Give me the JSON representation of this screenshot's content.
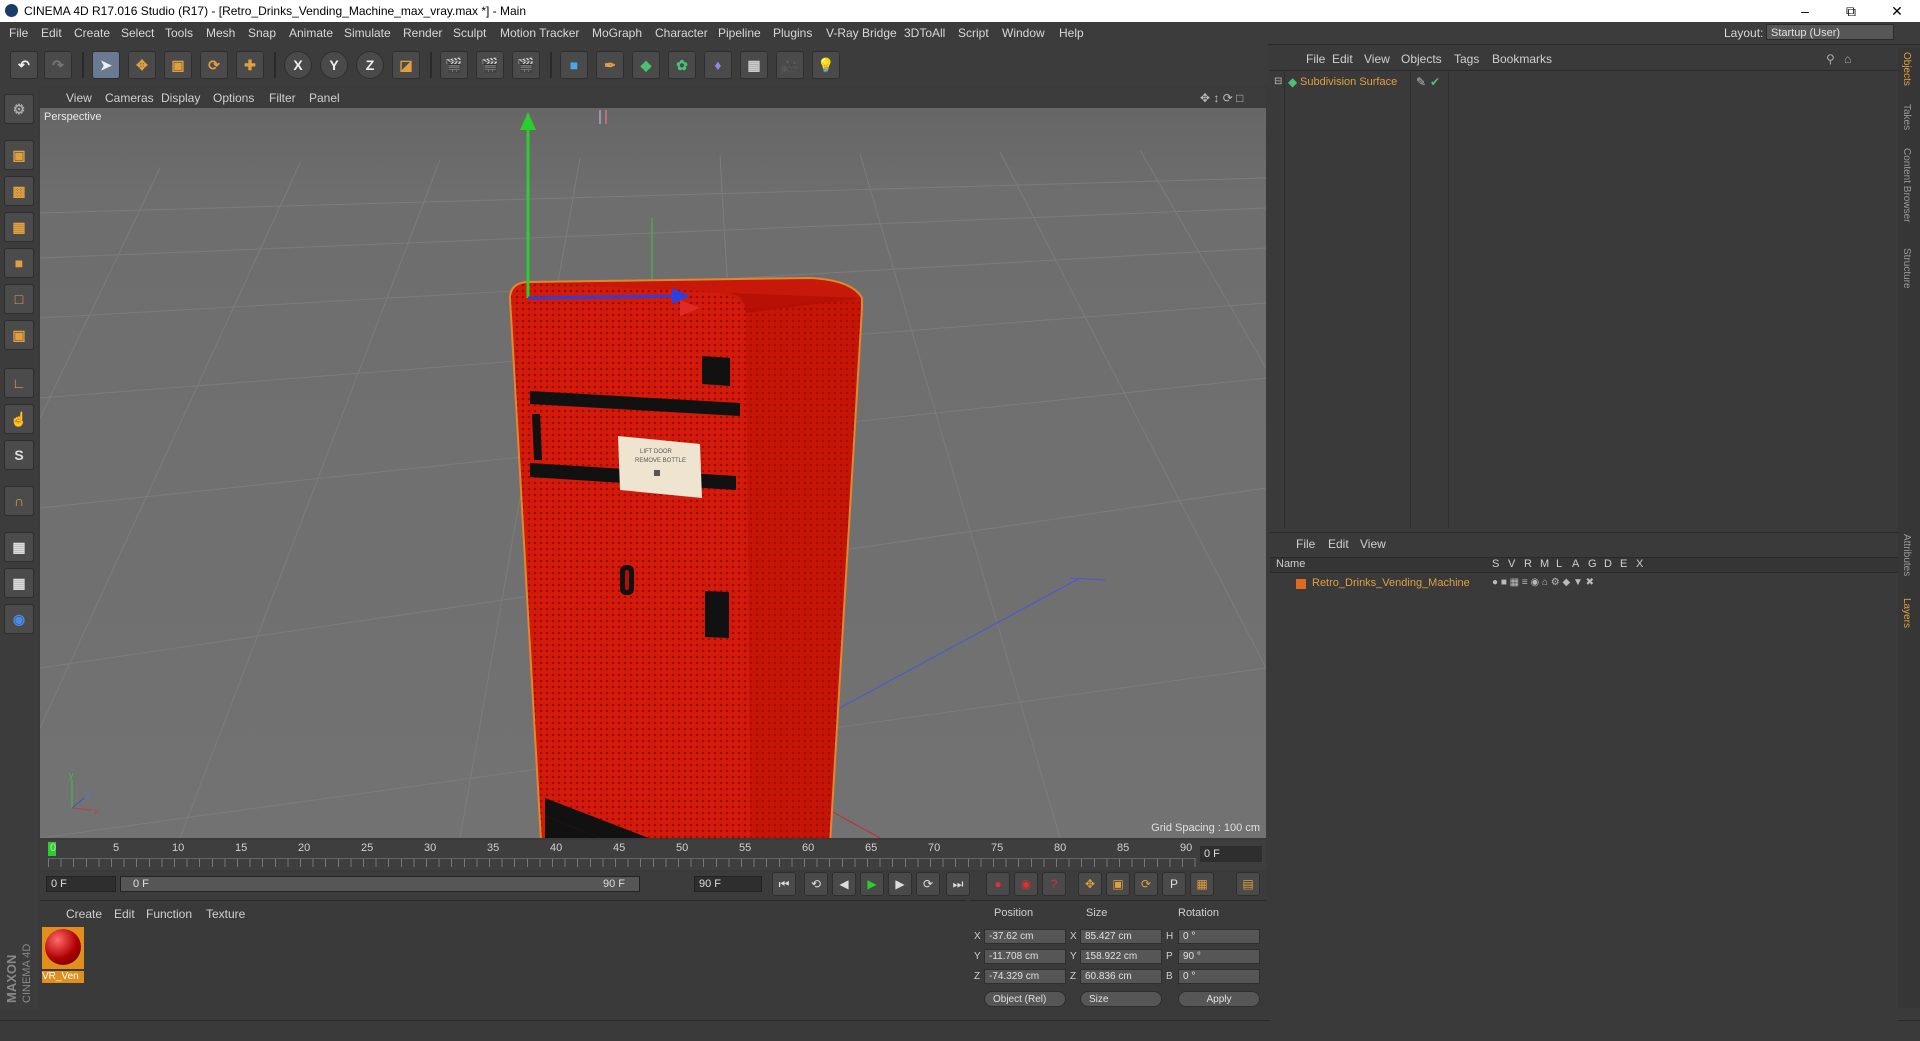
{
  "window": {
    "title": "CINEMA 4D R17.016 Studio (R17) - [Retro_Drinks_Vending_Machine_max_vray.max *] - Main",
    "minimize": "–",
    "restore": "⧉",
    "close": "✕"
  },
  "menubar": {
    "items": [
      "File",
      "Edit",
      "Create",
      "Select",
      "Tools",
      "Mesh",
      "Snap",
      "Animate",
      "Simulate",
      "Render",
      "Sculpt",
      "Motion Tracker",
      "MoGraph",
      "Character",
      "Pipeline",
      "Plugins",
      "V-Ray Bridge",
      "3DToAll",
      "Script",
      "Window",
      "Help"
    ],
    "layout_label": "Layout:",
    "layout_value": "Startup (User)"
  },
  "toolbar": {
    "axis_x": "X",
    "axis_y": "Y",
    "axis_z": "Z"
  },
  "viewport": {
    "menu": [
      "View",
      "Cameras",
      "Display",
      "Options",
      "Filter",
      "Panel"
    ],
    "label": "Perspective",
    "grid_spacing": "Grid Spacing : 100 cm",
    "plaque_lines": [
      "LIFT DOOR",
      "REMOVE BOTTLE"
    ]
  },
  "timeline": {
    "ticks": [
      "0",
      "5",
      "10",
      "15",
      "20",
      "25",
      "30",
      "35",
      "40",
      "45",
      "50",
      "55",
      "60",
      "65",
      "70",
      "75",
      "80",
      "85",
      "90"
    ],
    "current_frame": "0 F"
  },
  "transport": {
    "start_field": "0 F",
    "range_start": "0 F",
    "range_end": "90 F",
    "end_field": "90 F"
  },
  "material_manager": {
    "menu": [
      "Create",
      "Edit",
      "Function",
      "Texture"
    ],
    "material_name": "VR_Ven",
    "maxon_text": "MAXON",
    "c4d_text": "CINEMA 4D"
  },
  "coordinates": {
    "headers": [
      "Position",
      "Size",
      "Rotation"
    ],
    "rows": [
      {
        "axis": "X",
        "pos": "-37.62 cm",
        "size_axis": "X",
        "size": "85.427 cm",
        "rot_axis": "H",
        "rot": "0 °"
      },
      {
        "axis": "Y",
        "pos": "-11.708 cm",
        "size_axis": "Y",
        "size": "158.922 cm",
        "rot_axis": "P",
        "rot": "90 °"
      },
      {
        "axis": "Z",
        "pos": "-74.329 cm",
        "size_axis": "Z",
        "size": "60.836 cm",
        "rot_axis": "B",
        "rot": "0 °"
      }
    ],
    "mode_select": "Object (Rel)",
    "size_select": "Size",
    "apply": "Apply"
  },
  "object_manager": {
    "menu": [
      "File",
      "Edit",
      "View",
      "Objects",
      "Tags",
      "Bookmarks"
    ],
    "object_name": "Subdivision Surface"
  },
  "layer_manager": {
    "menu": [
      "File",
      "Edit",
      "View"
    ],
    "columns": [
      "Name",
      "S",
      "V",
      "R",
      "M",
      "L",
      "A",
      "G",
      "D",
      "E",
      "X"
    ],
    "layer_name": "Retro_Drinks_Vending_Machine"
  },
  "side_tabs": [
    "Objects",
    "Takes",
    "Content Browser",
    "Structure",
    "Attributes",
    "Layers"
  ],
  "colors": {
    "accent_orange": "#e0a040",
    "machine_red": "#d41a0a",
    "viewport_bg": "#6d6d6d"
  }
}
